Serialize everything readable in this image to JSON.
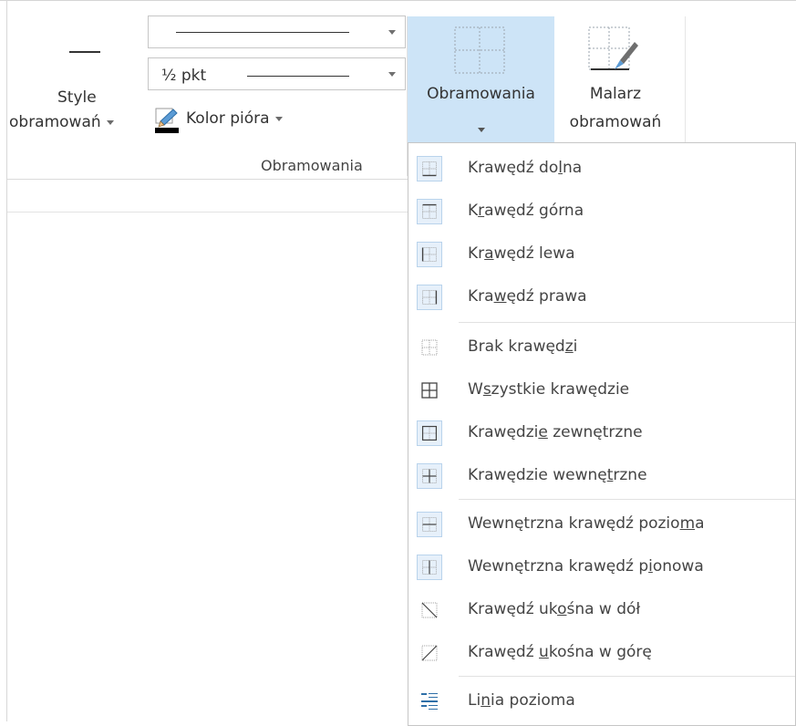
{
  "ribbon": {
    "style_button": {
      "line1": "Style",
      "line2": "obramowań"
    },
    "line_style_dropdown": {
      "value": "solid"
    },
    "line_weight_dropdown": {
      "value": "½ pkt"
    },
    "pen_color": {
      "label": "Kolor pióra",
      "color": "#000000"
    },
    "group_label": "Obramowania",
    "borders_button": {
      "label": "Obramowania"
    },
    "painter_button": {
      "line1": "Malarz",
      "line2": "obramowań"
    }
  },
  "colors": {
    "active_bg": "#cde4f7",
    "icon_box_bg": "#e6f0fa",
    "icon_box_border": "#b9d3ec"
  },
  "menu": {
    "items": [
      {
        "pre": "Krawędź do",
        "key": "l",
        "post": "na",
        "icon": "border-bottom-icon"
      },
      {
        "pre": "K",
        "key": "r",
        "post": "awędź górna",
        "icon": "border-top-icon"
      },
      {
        "pre": "Kr",
        "key": "a",
        "post": "wędź lewa",
        "icon": "border-left-icon"
      },
      {
        "pre": "Kra",
        "key": "w",
        "post": "ędź prawa",
        "icon": "border-right-icon"
      },
      {
        "pre": "Brak krawęd",
        "key": "z",
        "post": "i",
        "icon": "no-border-icon"
      },
      {
        "pre": "W",
        "key": "s",
        "post": "zystkie krawędzie",
        "icon": "all-borders-icon"
      },
      {
        "pre": "Krawędzi",
        "key": "e",
        "post": " zewnętrzne",
        "icon": "outside-borders-icon"
      },
      {
        "pre": "Krawędzie wewnę",
        "key": "t",
        "post": "rzne",
        "icon": "inside-borders-icon"
      },
      {
        "pre": "Wewnętrzna krawędź pozio",
        "key": "m",
        "post": "a",
        "icon": "inside-horizontal-border-icon"
      },
      {
        "pre": "Wewnętrzna krawędź p",
        "key": "i",
        "post": "onowa",
        "icon": "inside-vertical-border-icon"
      },
      {
        "pre": "Krawędź uk",
        "key": "o",
        "post": "śna w dół",
        "icon": "diagonal-down-border-icon"
      },
      {
        "pre": "Krawędź ",
        "key": "u",
        "post": "kośna w górę",
        "icon": "diagonal-up-border-icon"
      },
      {
        "pre": "Li",
        "key": "n",
        "post": "ia pozioma",
        "icon": "horizontal-line-icon"
      }
    ]
  }
}
